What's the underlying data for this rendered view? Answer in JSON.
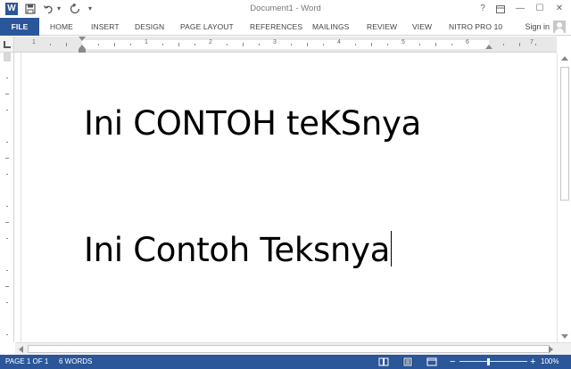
{
  "titlebar": {
    "title": "Document1 - Word",
    "logo_letter": "W",
    "quick_access": {
      "save_icon": "save-icon",
      "undo_icon": "undo-icon",
      "undo_dropdown": "▾",
      "redo_icon": "redo-icon",
      "customize_icon": "▾"
    },
    "window_controls": {
      "help": "?",
      "ribbon_display": "▣",
      "minimize": "—",
      "maximize": "☐",
      "close": "✕"
    }
  },
  "ribbon": {
    "tabs": [
      {
        "label": "FILE"
      },
      {
        "label": "HOME"
      },
      {
        "label": "INSERT"
      },
      {
        "label": "DESIGN"
      },
      {
        "label": "PAGE LAYOUT"
      },
      {
        "label": "REFERENCES"
      },
      {
        "label": "MAILINGS"
      },
      {
        "label": "REVIEW"
      },
      {
        "label": "VIEW"
      },
      {
        "label": "NITRO PRO 10"
      }
    ],
    "sign_in": "Sign in"
  },
  "document": {
    "line1": "Ini CONTOH teKSnya",
    "line2": "Ini Contoh Teksnya"
  },
  "ruler": {
    "numbers": [
      "1",
      "1",
      "2",
      "3",
      "4",
      "5",
      "6",
      "7"
    ]
  },
  "statusbar": {
    "page": "PAGE 1 OF 1",
    "words": "6 WORDS",
    "zoom_minus": "−",
    "zoom_plus": "+",
    "zoom_percent": "100%",
    "zoom_level": 100
  },
  "colors": {
    "accent": "#2b579a",
    "status_active": "#1e3f73"
  }
}
